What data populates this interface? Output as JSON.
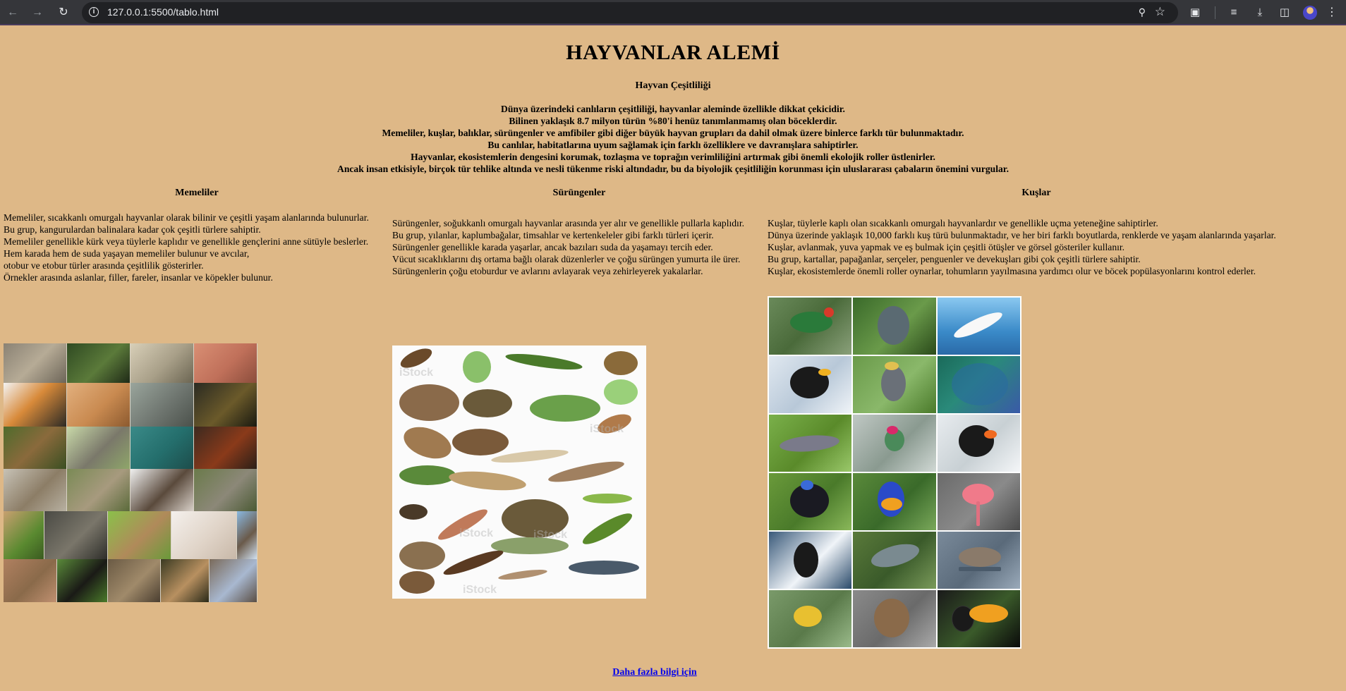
{
  "browser": {
    "url": "127.0.0.1:5500/tablo.html"
  },
  "page": {
    "title": "HAYVANLAR ALEMİ",
    "subtitle": "Hayvan Çeşitliliği",
    "intro": [
      "Dünya üzerindeki canlıların çeşitliliği, hayvanlar aleminde özellikle dikkat çekicidir.",
      "Bilinen yaklaşık 8.7 milyon türün %80'i henüz tanımlanmamış olan böceklerdir.",
      "Memeliler, kuşlar, balıklar, sürüngenler ve amfibiler gibi diğer büyük hayvan grupları da dahil olmak üzere binlerce farklı tür bulunmaktadır.",
      "Bu canlılar, habitatlarına uyum sağlamak için farklı özelliklere ve davranışlara sahiptirler.",
      "Hayvanlar, ekosistemlerin dengesini korumak, tozlaşma ve toprağın verimliliğini artırmak gibi önemli ekolojik roller üstlenirler.",
      "Ancak insan etkisiyle, birçok tür tehlike altında ve nesli tükenme riski altındadır, bu da biyolojik çeşitliliğin korunması için uluslararası çabaların önemini vurgular."
    ],
    "columns": [
      {
        "title": "Memeliler",
        "lines": [
          "Memeliler, sıcakkanlı omurgalı hayvanlar olarak bilinir ve çeşitli yaşam alanlarında bulunurlar.",
          "Bu grup, kangurulardan balinalara kadar çok çeşitli türlere sahiptir.",
          "Memeliler genellikle kürk veya tüylerle kaplıdır ve genellikle gençlerini anne sütüyle beslerler.",
          "Hem karada hem de suda yaşayan memeliler bulunur ve avcılar,",
          "otobur ve etobur türler arasında çeşitlilik gösterirler.",
          "Örnekler arasında aslanlar, filler, fareler, insanlar ve köpekler bulunur."
        ]
      },
      {
        "title": "Sürüngenler",
        "lines": [
          "Sürüngenler, soğukkanlı omurgalı hayvanlar arasında yer alır ve genellikle pullarla kaplıdır.",
          "Bu grup, yılanlar, kaplumbağalar, timsahlar ve kertenkeleler gibi farklı türleri içerir.",
          "Sürüngenler genellikle karada yaşarlar, ancak bazıları suda da yaşamayı tercih eder.",
          "Vücut sıcaklıklarını dış ortama bağlı olarak düzenlerler ve çoğu sürüngen yumurta ile ürer.",
          "Sürüngenlerin çoğu etoburdur ve avlarını avlayarak veya zehirleyerek yakalarlar."
        ]
      },
      {
        "title": "Kuşlar",
        "lines": [
          "Kuşlar, tüylerle kaplı olan sıcakkanlı omurgalı hayvanlardır ve genellikle uçma yeteneğine sahiptirler.",
          "Dünya üzerinde yaklaşık 10,000 farklı kuş türü bulunmaktadır, ve her biri farklı boyutlarda, renklerde ve yaşam alanlarında yaşarlar.",
          "Kuşlar, avlanmak, yuva yapmak ve eş bulmak için çeşitli ötüşler ve görsel gösteriler kullanır.",
          "Bu grup, kartallar, papağanlar, serçeler, penguenler ve devekuşları gibi çok çeşitli türlere sahiptir.",
          "Kuşlar, ekosistemlerde önemli roller oynarlar, tohumların yayılmasına yardımcı olur ve böcek popülasyonlarını kontrol ederler."
        ]
      }
    ],
    "link_label": "Daha fazla bilgi için"
  },
  "images": {
    "mammals_alt": "mammals-collage",
    "reptiles_alt": "reptiles-collage",
    "birds_alt": "birds-grid",
    "watermark_text": "iStock"
  }
}
